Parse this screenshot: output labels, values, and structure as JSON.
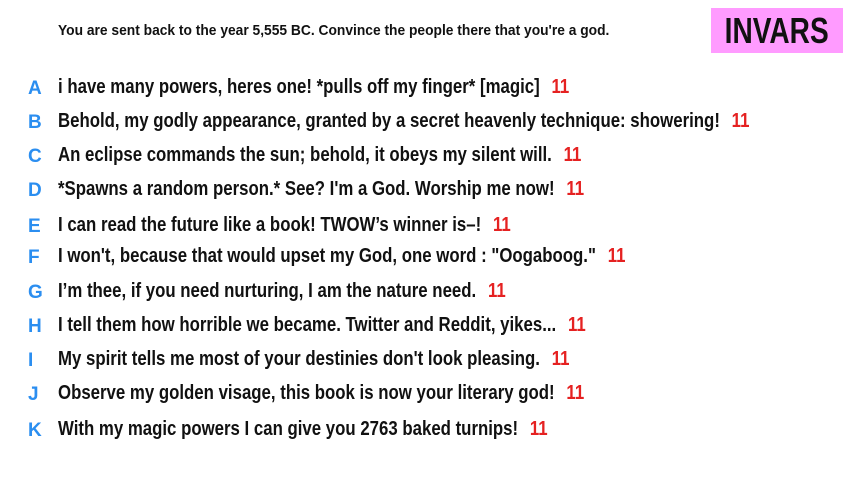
{
  "prompt": "You are sent back to the year 5,555 BC. Convince the people there that you're a god.",
  "badge": "INVARS",
  "responses": [
    {
      "letter": "A",
      "text": "i have many powers, heres one! *pulls off my finger* [magic]",
      "words": "11"
    },
    {
      "letter": "B",
      "text": "Behold, my godly appearance, granted by a secret heavenly technique: showering!",
      "words": "11"
    },
    {
      "letter": "C",
      "text": "An eclipse commands the sun; behold, it obeys my silent will.",
      "words": "11"
    },
    {
      "letter": "D",
      "text": "*Spawns a random person.* See? I'm a God. Worship me now!",
      "words": "11"
    },
    {
      "letter": "E",
      "text": "I can read the future like a book! TWOW’s winner is–!",
      "words": "11"
    },
    {
      "letter": "F",
      "text": "I won't, because that would upset my God, one word : \"Oogaboog.\"",
      "words": "11"
    },
    {
      "letter": "G",
      "text": "I’m thee, if you need nurturing, I am the nature need.",
      "words": "11"
    },
    {
      "letter": "H",
      "text": "I tell them how horrible we became. Twitter and Reddit, yikes...",
      "words": "11"
    },
    {
      "letter": "I",
      "text": "My spirit tells me most of your destinies don't look pleasing.",
      "words": "11"
    },
    {
      "letter": "J",
      "text": "Observe my golden visage, this book is now your literary god!",
      "words": "11"
    },
    {
      "letter": "K",
      "text": "With my magic powers I can give you 2763 baked turnips!",
      "words": "11"
    }
  ],
  "colors": {
    "letter": "#2b8ef0",
    "word_count": "#e52121",
    "badge_bg": "#ff9bff",
    "text": "#111111"
  }
}
